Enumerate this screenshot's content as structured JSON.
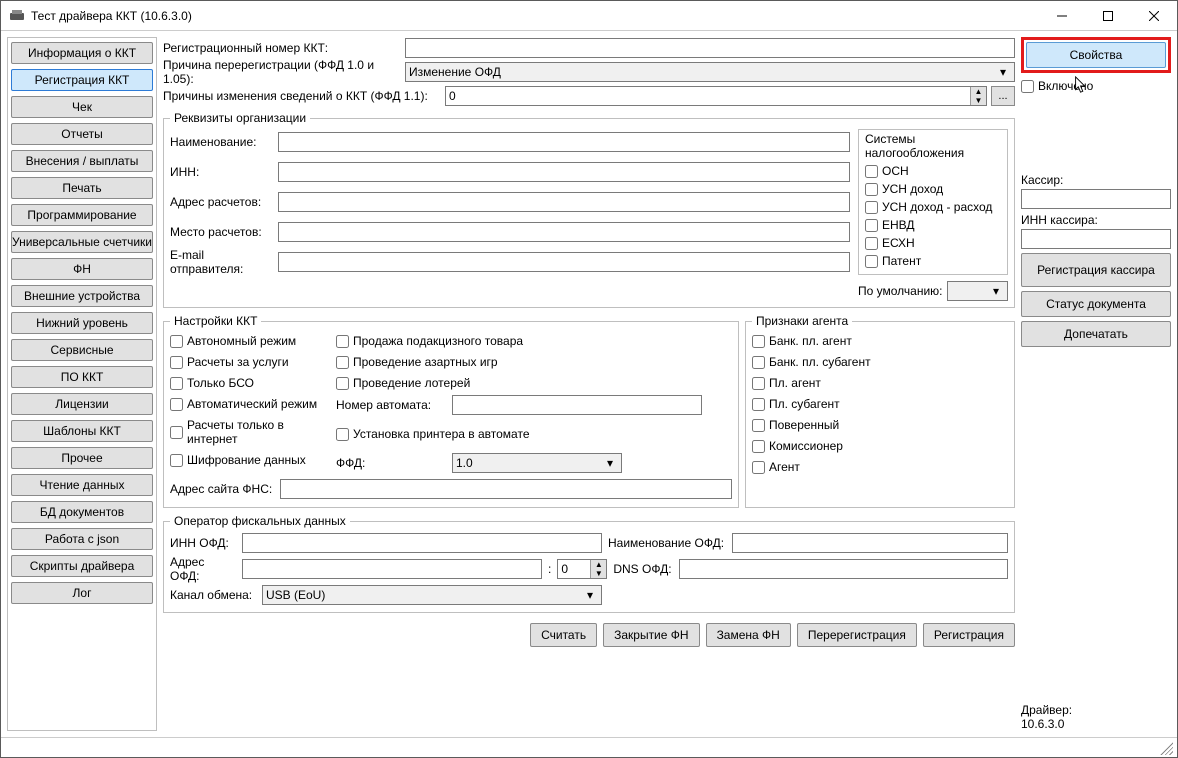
{
  "window": {
    "title": "Тест драйвера ККТ (10.6.3.0)"
  },
  "sidebar": {
    "items": [
      "Информация о ККТ",
      "Регистрация ККТ",
      "Чек",
      "Отчеты",
      "Внесения / выплаты",
      "Печать",
      "Программирование",
      "Универсальные счетчики",
      "ФН",
      "Внешние устройства",
      "Нижний уровень",
      "Сервисные",
      "ПО ККТ",
      "Лицензии",
      "Шаблоны ККТ",
      "Прочее",
      "Чтение данных",
      "БД документов",
      "Работа с json",
      "Скрипты драйвера",
      "Лог"
    ],
    "active_index": 1
  },
  "top_fields": {
    "reg_number_label": "Регистрационный номер ККТ:",
    "reg_number_value": "",
    "rereg_reason_label": "Причина перерегистрации (ФФД 1.0 и 1.05):",
    "rereg_reason_value": "Изменение ОФД",
    "change_reasons_label": "Причины изменения сведений о ККТ (ФФД 1.1):",
    "change_reasons_value": "0",
    "dots": "..."
  },
  "org": {
    "legend": "Реквизиты организации",
    "name_label": "Наименование:",
    "name_value": "",
    "inn_label": "ИНН:",
    "inn_value": "",
    "calc_addr_label": "Адрес расчетов:",
    "calc_addr_value": "",
    "calc_place_label": "Место расчетов:",
    "calc_place_value": "",
    "email_label": "E-mail отправителя:",
    "email_value": "",
    "tax_title": "Системы налогообложения",
    "taxes": [
      "ОСН",
      "УСН доход",
      "УСН доход - расход",
      "ЕНВД",
      "ЕСХН",
      "Патент"
    ],
    "default_label": "По умолчанию:",
    "default_value": ""
  },
  "kkt": {
    "legend": "Настройки ККТ",
    "col1": [
      "Автономный режим",
      "Расчеты за услуги",
      "Только БСО",
      "Автоматический режим",
      "Расчеты только в интернет",
      "Шифрование данных"
    ],
    "col2": [
      "Продажа подакцизного товара",
      "Проведение азартных игр",
      "Проведение лотерей"
    ],
    "automat_label": "Номер автомата:",
    "automat_value": "",
    "printer_label": "Установка принтера в автомате",
    "ffd_label": "ФФД:",
    "ffd_value": "1.0",
    "fns_label": "Адрес сайта ФНС:",
    "fns_value": "",
    "agents_legend": "Признаки агента",
    "agents": [
      "Банк. пл. агент",
      "Банк. пл. субагент",
      "Пл. агент",
      "Пл. субагент",
      "Поверенный",
      "Комиссионер",
      "Агент"
    ]
  },
  "ofd": {
    "legend": "Оператор фискальных данных",
    "inn_label": "ИНН ОФД:",
    "inn_value": "",
    "name_label": "Наименование ОФД:",
    "name_value": "",
    "addr_label": "Адрес ОФД:",
    "addr_value": "",
    "port_value": "0",
    "dns_label": "DNS ОФД:",
    "dns_value": "",
    "channel_label": "Канал обмена:",
    "channel_value": "USB (EoU)"
  },
  "actions": {
    "read": "Считать",
    "close_fn": "Закрытие ФН",
    "replace_fn": "Замена ФН",
    "rereg": "Перерегистрация",
    "reg": "Регистрация"
  },
  "right": {
    "properties": "Свойства",
    "enabled": "Включено",
    "cashier_label": "Кассир:",
    "cashier_value": "",
    "cashier_inn_label": "ИНН кассира:",
    "cashier_inn_value": "",
    "reg_cashier": "Регистрация кассира",
    "doc_status": "Статус документа",
    "reprint": "Допечатать",
    "driver_label": "Драйвер:",
    "driver_version": "10.6.3.0"
  }
}
